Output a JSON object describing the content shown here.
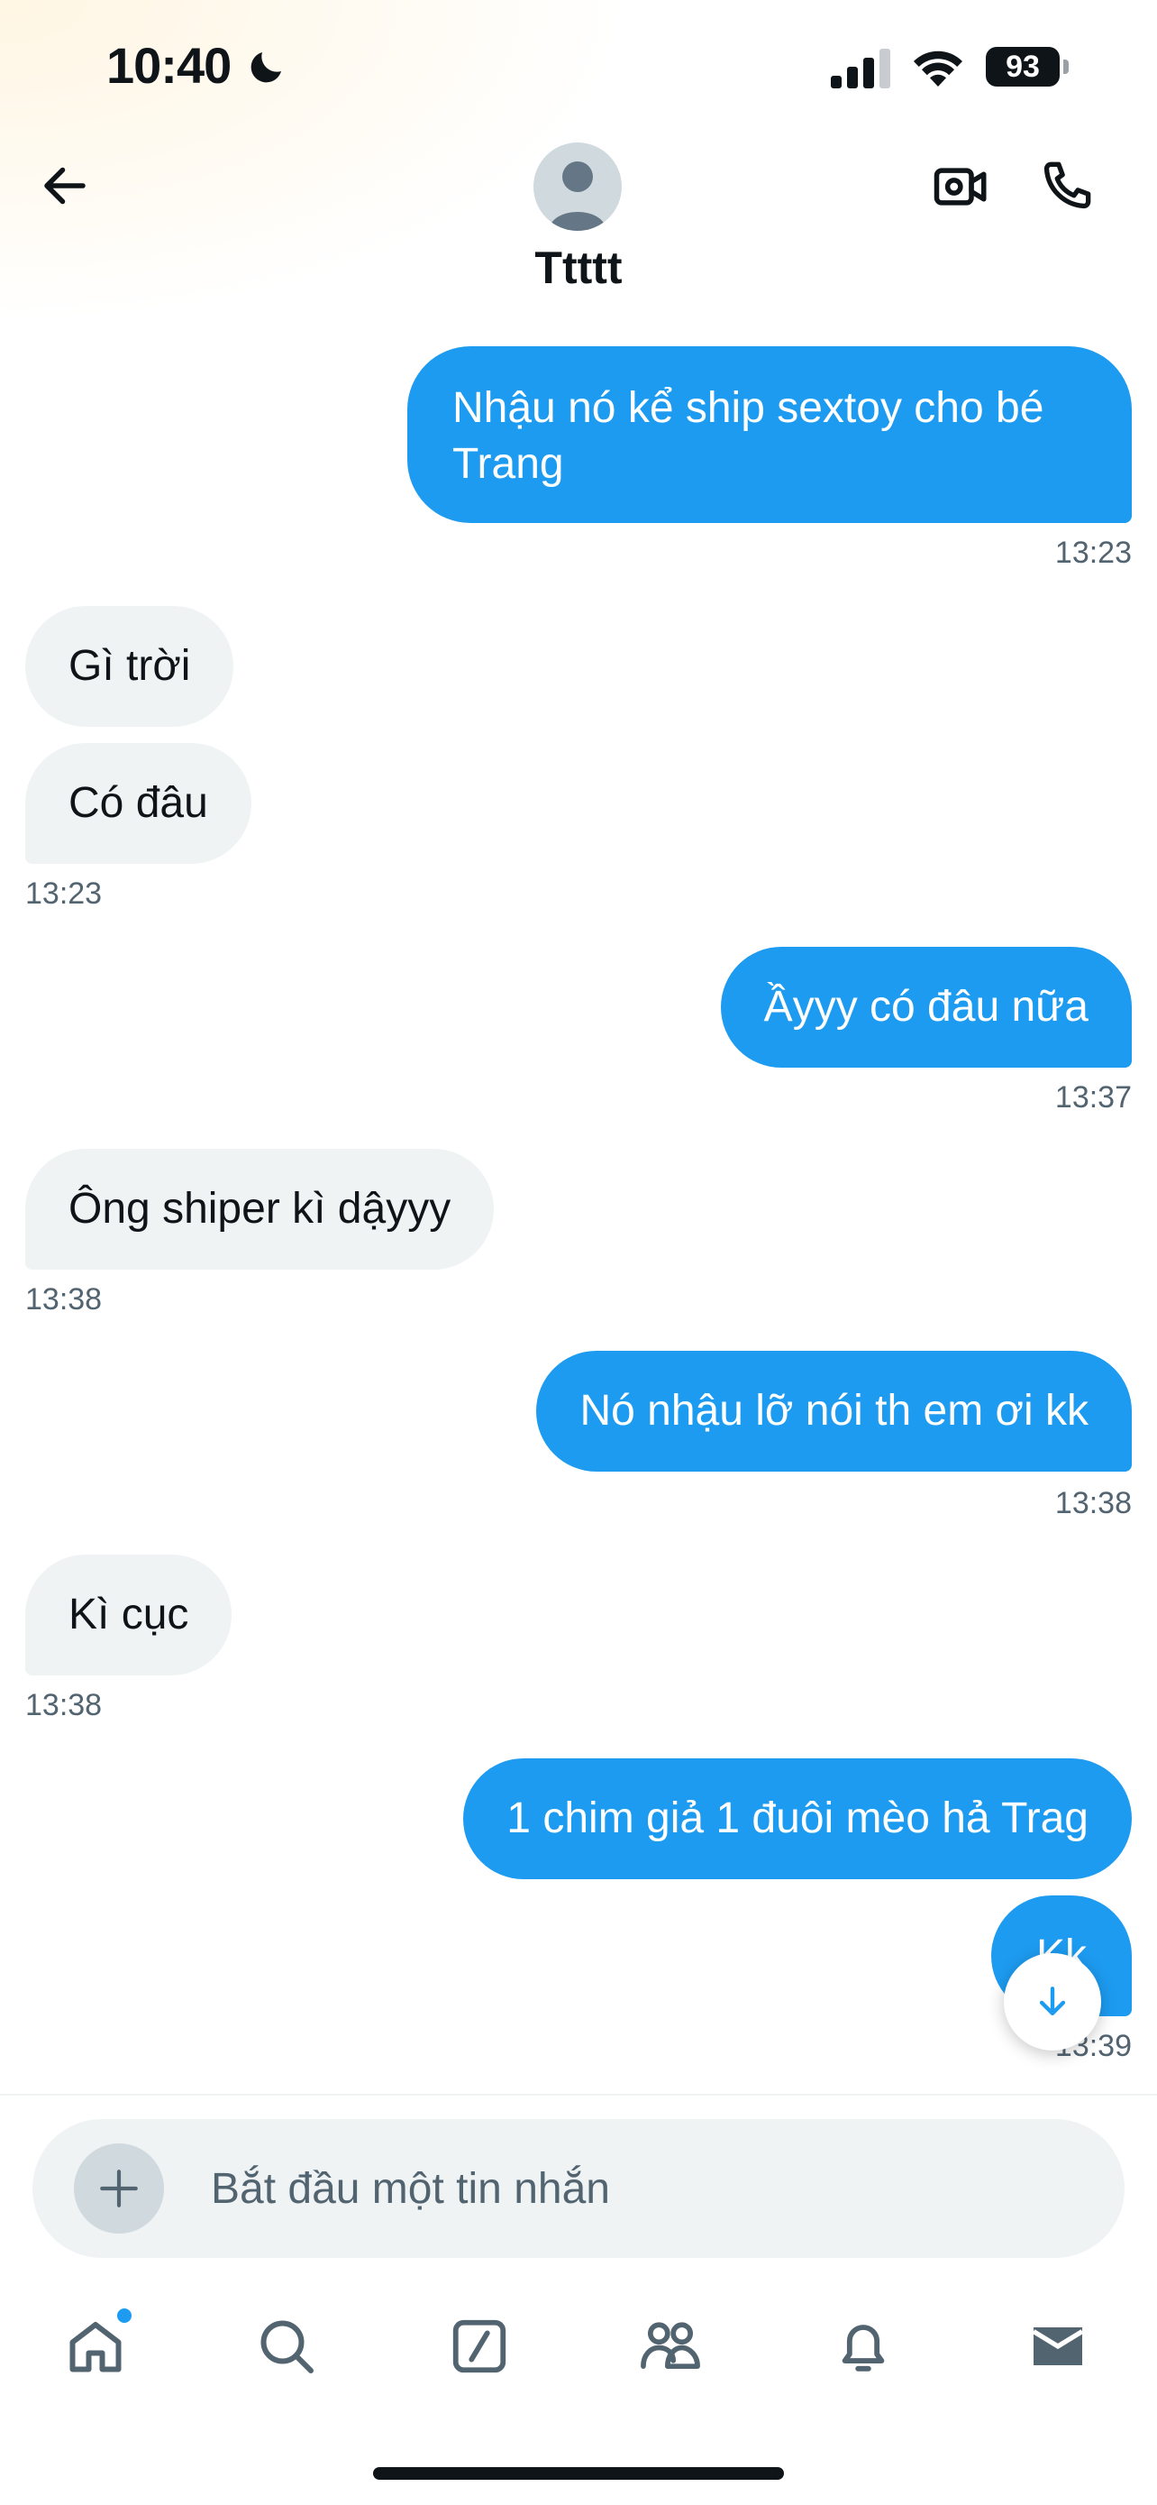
{
  "status_bar": {
    "time": "10:40",
    "battery": "93"
  },
  "header": {
    "contact_name": "Ttttt"
  },
  "messages": [
    {
      "direction": "sent",
      "text": "Nhậu nó kể ship sextoy cho bé\nTrang"
    },
    {
      "direction": "sent_time",
      "text": "13:23"
    },
    {
      "direction": "received",
      "text": "Gì trời"
    },
    {
      "direction": "received",
      "text": "Có đâu"
    },
    {
      "direction": "received_time",
      "text": "13:23"
    },
    {
      "direction": "sent",
      "text": "Ầyyy có đâu nữa"
    },
    {
      "direction": "sent_time",
      "text": "13:37"
    },
    {
      "direction": "received",
      "text": "Ông shiper kì dậyyy"
    },
    {
      "direction": "received_time",
      "text": "13:38"
    },
    {
      "direction": "sent",
      "text": "Nó nhậu lỡ nói th em ơi kk"
    },
    {
      "direction": "sent_time",
      "text": "13:38"
    },
    {
      "direction": "received",
      "text": "Kì cục"
    },
    {
      "direction": "received_time",
      "text": "13:38"
    },
    {
      "direction": "sent",
      "text": "1 chim giả 1 đuôi mèo hả Trag"
    },
    {
      "direction": "sent",
      "text": "Kk"
    },
    {
      "direction": "sent_time",
      "text": "13:39"
    }
  ],
  "composer": {
    "placeholder": "Bắt đầu một tin nhắn"
  },
  "tab_bar": {
    "items": [
      "home-icon",
      "search-icon",
      "grok-icon",
      "communities-icon",
      "notifications-icon",
      "messages-icon"
    ],
    "home_has_badge": true
  },
  "colors": {
    "sent_bubble": "#1d9bf0",
    "received_bubble": "#eff3f4",
    "timestamp": "#536471",
    "badge": "#1d9bf0",
    "voice_icon": "#8b5cf6"
  }
}
